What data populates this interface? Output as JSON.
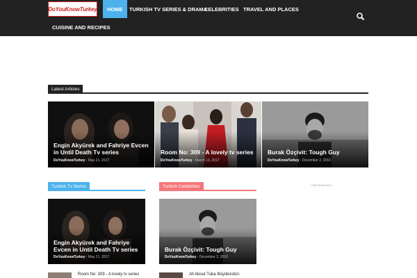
{
  "header": {
    "logo_text": "DoYouKnowTurkey",
    "nav": [
      {
        "label": "HOME",
        "active": true
      },
      {
        "label": "TURKISH TV SERIES & DRAMA",
        "active": false
      },
      {
        "label": "CELEBRITIES",
        "active": false
      },
      {
        "label": "TRAVEL AND PLACES",
        "active": false
      },
      {
        "label": "CUISINE AND RECIPES",
        "active": false
      }
    ],
    "search_icon": "search-icon"
  },
  "latest": {
    "section_title": "Latest Articles",
    "accent": "#222222",
    "articles": [
      {
        "title": "Engin Akyürek and Fahriye Evcen in Until Death Tv series",
        "author": "DoYouKnowTurkey",
        "date": "May 21, 2017"
      },
      {
        "title": "Room No: 309 - A lovely tv series",
        "author": "DoYouKnowTurkey",
        "date": "March 13, 2017"
      },
      {
        "title": "Burak Özçivit: Tough Guy",
        "author": "DoYouKnowTurkey",
        "date": "December 2, 2016"
      }
    ]
  },
  "tv_series": {
    "section_title": "Turkish Tv Series",
    "accent": "#4db2ec",
    "feature": {
      "title": "Engin Akyürek and Fahriye Evcen in Until Death Tv series",
      "author": "DoYouKnowTurkey",
      "date": "May 21, 2017"
    },
    "next_title": "Room No: 309 - A lovely tv series"
  },
  "celebrities": {
    "section_title": "Turkish Celebrities",
    "accent": "#f4777b",
    "feature": {
      "title": "Burak Özçivit: Tough Guy",
      "author": "DoYouKnowTurkey",
      "date": "December 2, 2016"
    },
    "next_title": "All About Tuba Büyüküstün:"
  },
  "sidebar": {
    "ad_label": "- Advertisement -"
  },
  "meta_separator": " - "
}
